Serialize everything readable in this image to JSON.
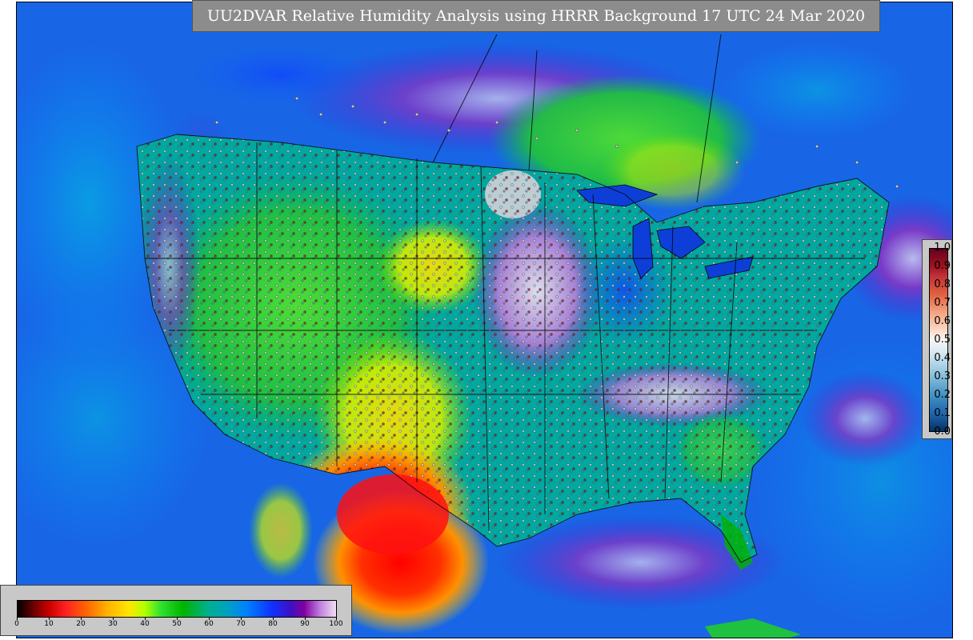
{
  "title": "UU2DVAR Relative Humidity Analysis using HRRR Background 17 UTC 24 Mar 2020",
  "obs_legend": {
    "ticks": [
      "1.0",
      "0.9",
      "0.8",
      "0.7",
      "0.6",
      "0.5",
      "0.4",
      "0.3",
      "0.2",
      "0.1",
      "0.0"
    ]
  },
  "rh_legend": {
    "ticks": [
      "0",
      "10",
      "20",
      "30",
      "40",
      "50",
      "60",
      "70",
      "80",
      "90",
      "100"
    ]
  },
  "colors": {
    "ocean": "#1e6fe0",
    "land_humid": "#00b890",
    "dry": "#ff2a00",
    "very_humid": "#7010c0",
    "title_bg": "#8c8c8c"
  }
}
